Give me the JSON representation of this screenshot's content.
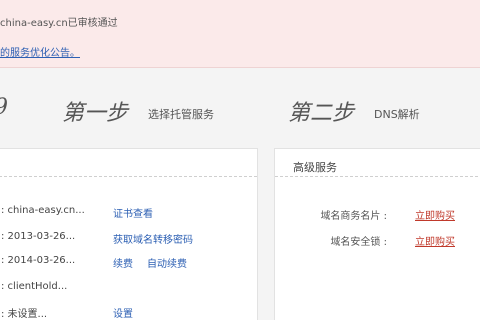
{
  "notice": {
    "text": "china-easy.cn已审核通过",
    "link": "的服务优化公告。"
  },
  "steps": {
    "edge_glyph": "9",
    "items": [
      {
        "num": "第一步",
        "desc": "选择托管服务"
      },
      {
        "num": "第二步",
        "desc": "DNS解析"
      }
    ]
  },
  "domain_info": {
    "rows": [
      {
        "value": ": china-easy.cn...",
        "actions": [
          "证书查看"
        ]
      },
      {
        "value": ": 2013-03-26...",
        "actions": [
          "获取域名转移密码"
        ]
      },
      {
        "value": ": 2014-03-26...",
        "actions": [
          "续费",
          "自动续费"
        ]
      },
      {
        "value": ": clientHold...",
        "actions": []
      },
      {
        "value": ": 未设置...",
        "actions": [
          "设置"
        ]
      }
    ]
  },
  "advanced": {
    "title": "高级服务",
    "services": [
      {
        "label": "域名商务名片 :",
        "action": "立即购买"
      },
      {
        "label": "域名安全锁 :",
        "action": "立即购买"
      }
    ]
  },
  "colors": {
    "notice_bg": "#fbeaea",
    "link": "#2c5fb3",
    "buy": "#c0392b"
  }
}
